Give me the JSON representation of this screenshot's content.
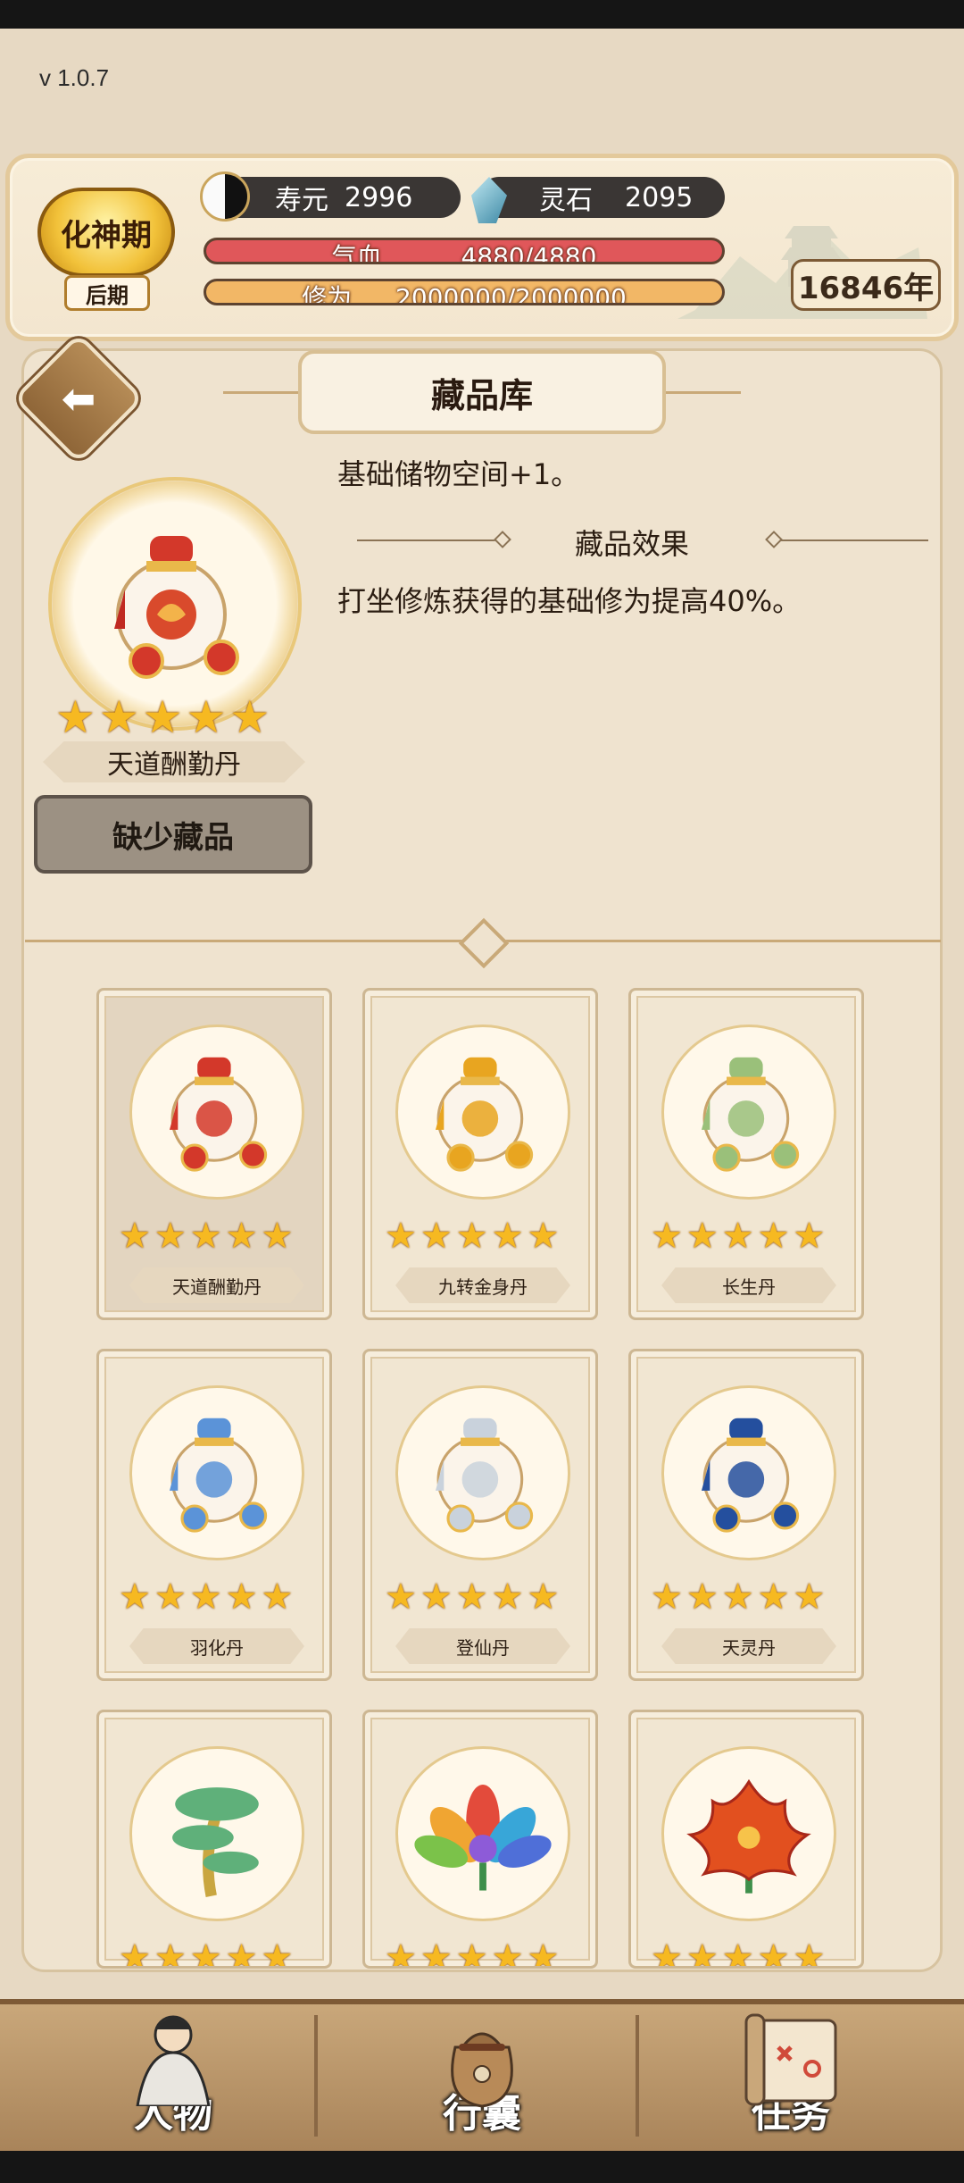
{
  "app": {
    "version": "v 1.0.7"
  },
  "header": {
    "realm": "化神期",
    "realm_stage": "后期",
    "lifespan_label": "寿元",
    "lifespan_value": "2996",
    "spirit_stone_label": "灵石",
    "spirit_stone_value": "2095",
    "hp_label": "气血",
    "hp_value": "4880/4880",
    "hp_fraction": 1.0,
    "cultivation_label": "修为",
    "cultivation_value": "2000000/2000000",
    "cultivation_fraction": 1.0,
    "years": "16846年",
    "colors": {
      "hp": "#e0575a",
      "cultivation": "#f2b766"
    }
  },
  "page": {
    "title": "藏品库",
    "back_icon": "arrow-left-icon"
  },
  "detail": {
    "base_effect": "基础储物空间+1。",
    "effect_title": "藏品效果",
    "effect_text": "打坐修炼获得的基础修为提高40%。",
    "item_name": "天道酬勤丹",
    "stars": 5,
    "action_label": "缺少藏品",
    "icon": "red-elixir-gourd-icon"
  },
  "collection": [
    {
      "name": "天道酬勤丹",
      "stars": 5,
      "icon": "red-elixir-gourd-icon",
      "color": "#d3382a",
      "selected": true
    },
    {
      "name": "九转金身丹",
      "stars": 5,
      "icon": "gold-elixir-gourd-icon",
      "color": "#e8a520",
      "selected": false
    },
    {
      "name": "长生丹",
      "stars": 5,
      "icon": "green-elixir-gourd-icon",
      "color": "#9ac07a",
      "selected": false
    },
    {
      "name": "羽化丹",
      "stars": 5,
      "icon": "blue-elixir-gourd-icon",
      "color": "#5b93d8",
      "selected": false
    },
    {
      "name": "登仙丹",
      "stars": 5,
      "icon": "silver-elixir-gourd-icon",
      "color": "#c9d2dc",
      "selected": false
    },
    {
      "name": "天灵丹",
      "stars": 5,
      "icon": "navy-elixir-gourd-icon",
      "color": "#244f9e",
      "selected": false
    },
    {
      "name": "",
      "stars": 5,
      "icon": "spirit-tree-icon",
      "color": "#5fb07a",
      "selected": false
    },
    {
      "name": "",
      "stars": 5,
      "icon": "rainbow-lotus-icon",
      "color": "#8d5bd8",
      "selected": false
    },
    {
      "name": "",
      "stars": 5,
      "icon": "fire-flower-icon",
      "color": "#e2501f",
      "selected": false
    }
  ],
  "nav": [
    {
      "label": "人物",
      "icon": "character-icon"
    },
    {
      "label": "行囊",
      "icon": "bag-icon"
    },
    {
      "label": "任务",
      "icon": "scroll-icon"
    }
  ]
}
